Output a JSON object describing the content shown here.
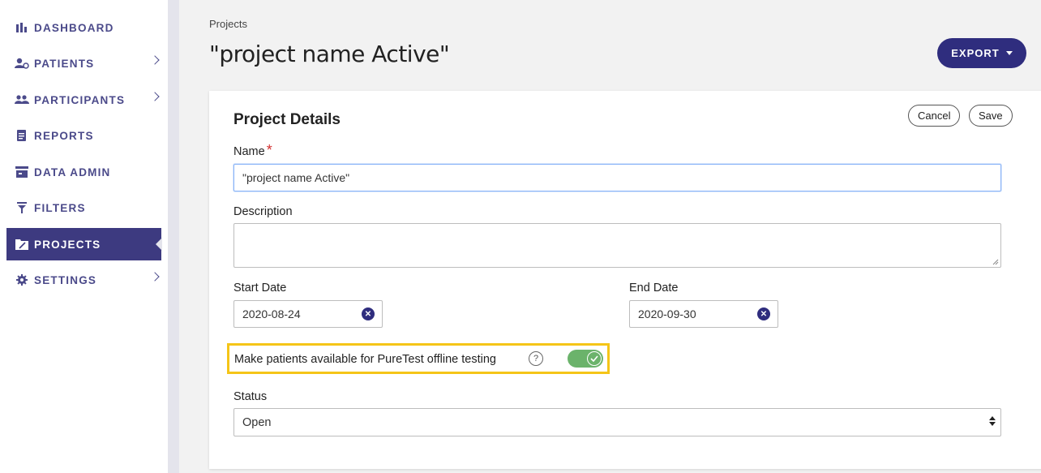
{
  "sidebar": {
    "items": [
      {
        "label": "DASHBOARD",
        "icon": "bar-chart-icon",
        "has_submenu": false
      },
      {
        "label": "PATIENTS",
        "icon": "patient-icon",
        "has_submenu": true
      },
      {
        "label": "PARTICIPANTS",
        "icon": "participants-icon",
        "has_submenu": true
      },
      {
        "label": "REPORTS",
        "icon": "report-icon",
        "has_submenu": false
      },
      {
        "label": "DATA ADMIN",
        "icon": "data-admin-icon",
        "has_submenu": false
      },
      {
        "label": "FILTERS",
        "icon": "filter-icon",
        "has_submenu": false
      },
      {
        "label": "PROJECTS",
        "icon": "projects-icon",
        "has_submenu": false,
        "active": true
      },
      {
        "label": "SETTINGS",
        "icon": "gear-icon",
        "has_submenu": true
      }
    ]
  },
  "header": {
    "breadcrumb": "Projects",
    "title": "\"project name Active\"",
    "export_label": "EXPORT"
  },
  "card": {
    "title": "Project Details",
    "cancel_label": "Cancel",
    "save_label": "Save",
    "name_label": "Name",
    "required_mark": "*",
    "name_value": "\"project name Active\"",
    "description_label": "Description",
    "description_value": "",
    "start_date_label": "Start Date",
    "start_date_value": "2020-08-24",
    "end_date_label": "End Date",
    "end_date_value": "2020-09-30",
    "offline_label": "Make patients available for PureTest offline testing",
    "help_glyph": "?",
    "offline_enabled": true,
    "status_label": "Status",
    "status_value": "Open"
  },
  "colors": {
    "brand": "#2f2d7e",
    "nav_text": "#4b4a8a",
    "active_nav": "#3d3a80",
    "toggle_on": "#6bb36b",
    "highlight": "#f5c518",
    "required": "#d32f2f"
  }
}
